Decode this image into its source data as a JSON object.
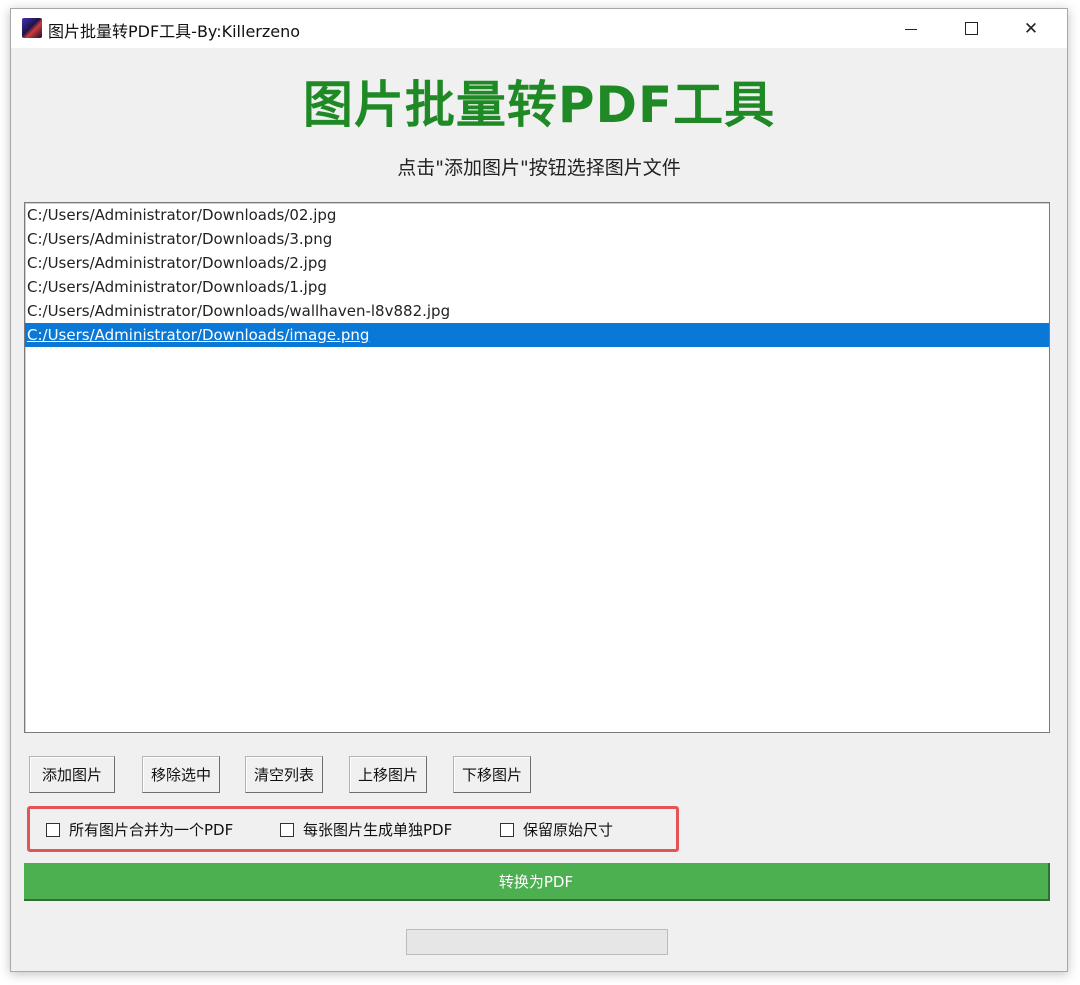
{
  "window": {
    "title": "图片批量转PDF工具-By:Killerzeno",
    "close_glyph": "✕"
  },
  "header": {
    "title": "图片批量转PDF工具",
    "subtitle": "点击\"添加图片\"按钮选择图片文件"
  },
  "file_list": {
    "items": [
      "C:/Users/Administrator/Downloads/02.jpg",
      "C:/Users/Administrator/Downloads/3.png",
      "C:/Users/Administrator/Downloads/2.jpg",
      "C:/Users/Administrator/Downloads/1.jpg",
      "C:/Users/Administrator/Downloads/wallhaven-l8v882.jpg",
      "C:/Users/Administrator/Downloads/image.png"
    ],
    "selected_index": 5
  },
  "toolbar": {
    "add_label": "添加图片",
    "remove_label": "移除选中",
    "clear_label": "清空列表",
    "move_up_label": "上移图片",
    "move_down_label": "下移图片"
  },
  "options": {
    "merge_label": "所有图片合并为一个PDF",
    "merge_checked": false,
    "separate_label": "每张图片生成单独PDF",
    "separate_checked": false,
    "keep_size_label": "保留原始尺寸",
    "keep_size_checked": false
  },
  "convert": {
    "label": "转换为PDF"
  },
  "progress": {
    "value": 0
  },
  "colors": {
    "title_green": "#1f8a25",
    "convert_green": "#4caf50",
    "selection_blue": "#0a78d7",
    "highlight_red": "#e55454"
  }
}
